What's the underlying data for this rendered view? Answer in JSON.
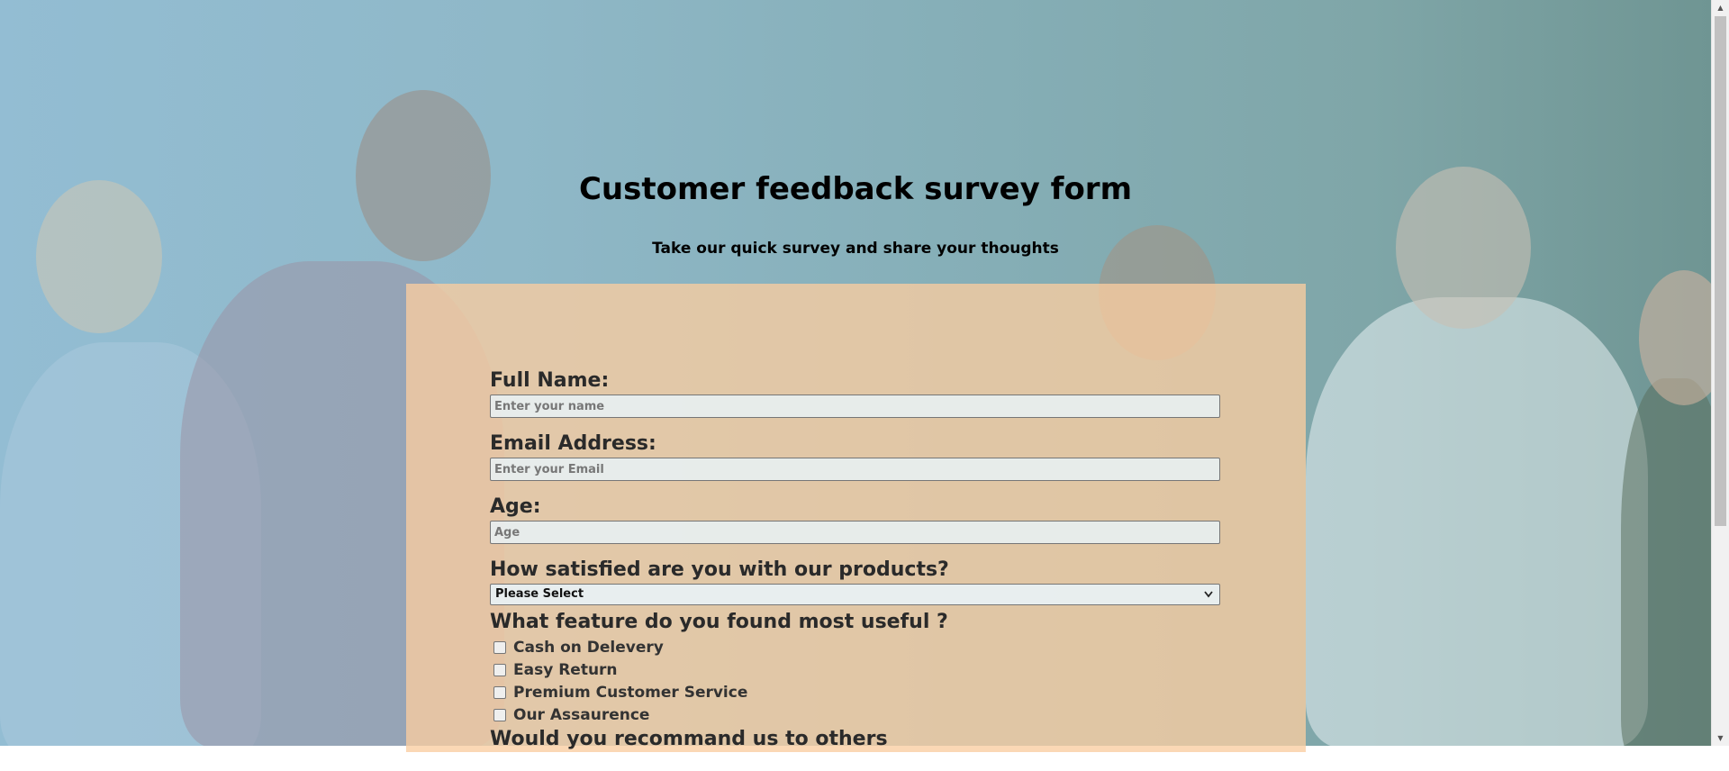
{
  "header": {
    "title": "Customer feedback survey form",
    "subtitle": "Take our quick survey and share your thoughts"
  },
  "form": {
    "name_label": "Full Name:",
    "name_placeholder": "Enter your name",
    "email_label": "Email Address:",
    "email_placeholder": "Enter your Email",
    "age_label": "Age:",
    "age_placeholder": "Age",
    "satisfaction_label": "How satisfied are you with our products?",
    "satisfaction_selected": "Please Select",
    "feature_label": "What feature do you found most useful ?",
    "features": [
      {
        "label": "Cash on Delevery",
        "checked": false
      },
      {
        "label": "Easy Return",
        "checked": false
      },
      {
        "label": "Premium Customer Service",
        "checked": false
      },
      {
        "label": "Our Assaurence",
        "checked": false
      }
    ],
    "recommend_label": "Would you recommand us to others"
  },
  "icons": {
    "select_chevron": "chevron-down-icon",
    "scroll_up": "scroll-up-icon",
    "scroll_down": "scroll-down-icon"
  }
}
